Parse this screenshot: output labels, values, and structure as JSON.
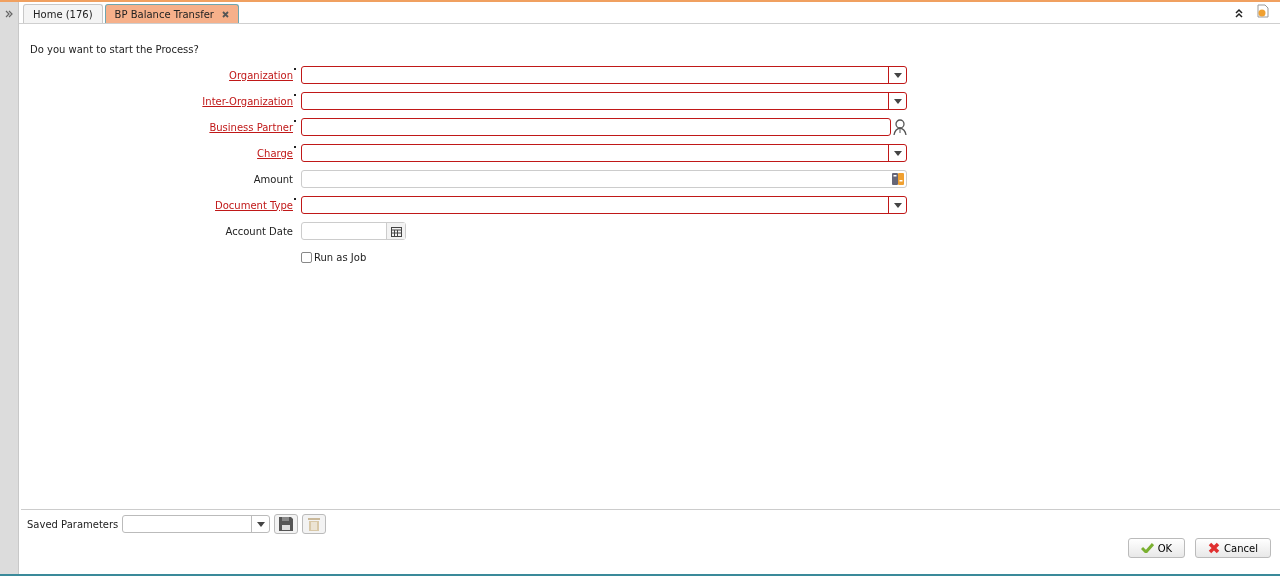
{
  "tabs": [
    {
      "label": "Home (176)",
      "selected": false,
      "closable": false
    },
    {
      "label": "BP Balance Transfer",
      "selected": true,
      "closable": true
    }
  ],
  "prompt": "Do you want to start the Process?",
  "fields": [
    {
      "label": "Organization",
      "kind": "select",
      "mandatory": true
    },
    {
      "label": "Inter-Organization",
      "kind": "select",
      "mandatory": true
    },
    {
      "label": "Business Partner",
      "kind": "search",
      "mandatory": true
    },
    {
      "label": "Charge",
      "kind": "select",
      "mandatory": true
    },
    {
      "label": "Amount",
      "kind": "number",
      "mandatory": false
    },
    {
      "label": "Document Type",
      "kind": "select",
      "mandatory": true
    },
    {
      "label": "Account Date",
      "kind": "date",
      "mandatory": false
    }
  ],
  "run_as_job": {
    "label": "Run as Job",
    "checked": false
  },
  "saved_parameters": {
    "label": "Saved Parameters"
  },
  "buttons": [
    {
      "label": "OK",
      "kind": "ok"
    },
    {
      "label": "Cancel",
      "kind": "cancel"
    }
  ]
}
